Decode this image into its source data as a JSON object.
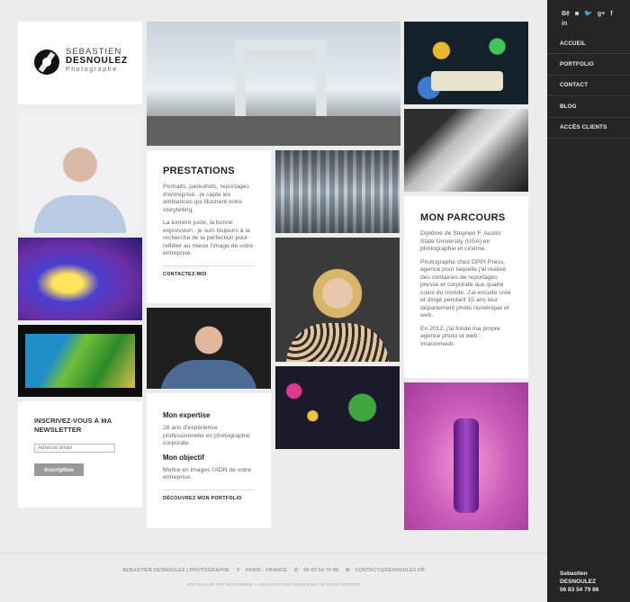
{
  "logo": {
    "line1": "SEBASTIEN",
    "line2": "DESNOULEZ",
    "line3": "Photographe"
  },
  "social": [
    "Bē",
    "◙",
    "🐦",
    "g+",
    "f",
    "in"
  ],
  "nav": [
    "ACCUEIL",
    "PORTFOLIO",
    "CONTACT",
    "BLOG",
    "ACCÈS CLIENTS"
  ],
  "sidebar_contact": {
    "name1": "Sebastien",
    "name2": "DESNOULEZ",
    "phone": "06 83 54 79 86"
  },
  "prestations": {
    "title": "PRESTATIONS",
    "p1": "Portraits, packshots, reportages d'entreprise.. je capte les ambiances qui illustrent votre storytelling.",
    "p2": "La lumière juste, la bonne expression.. je suis toujours à la recherche de la perfection pour refléter au mieux l'image de votre entreprise.",
    "cta": "CONTACTEZ-MOI"
  },
  "expertise": {
    "h1": "Mon expertise",
    "t1": "28 ans d'expérience professionnelle en photographie corporate.",
    "h2": "Mon objectif",
    "t2": "Mettre en images l'ADN de votre entreprise.",
    "cta": "DÉCOUVREZ MON PORTFOLIO"
  },
  "parcours": {
    "title": "MON PARCOURS",
    "p1": "Diplôme de Stephen F. Austin State University (USA) en photographie et cinéma.",
    "p2": "Photographe chez DPPI Press, agence pour laquelle j'ai réalisé des centaines de reportages presse et corporate aux quatre coins du monde. J'ai ensuite créé et dirigé pendant 15 ans leur département photo numérique et web.",
    "p3": "En 2012, j'ai fondé ma propre agence photo et web : Imacomweb."
  },
  "newsletter": {
    "title": "INSCRIVEZ-VOUS À MA NEWSLETTER",
    "placeholder": "Adresse email",
    "button": "Inscription"
  },
  "footer": {
    "company": "SEBASTIEN DESNOULEZ | PHOTOGRAPHE",
    "location": "PARIS - FRANCE",
    "phone": "06 83 54 79 86",
    "email": "CONTACT@DESNOULEZ.FR",
    "credit": "SITE RÉALISÉ PAR IMACOMWEB, LA MANUFACTURE PARISIENNE DE SITES INTERNET"
  }
}
